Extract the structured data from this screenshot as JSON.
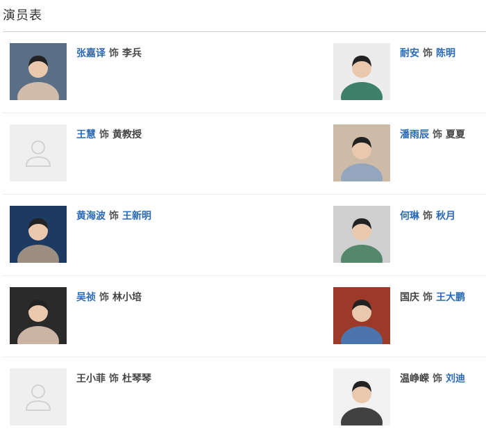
{
  "page": {
    "title": "演员表",
    "separator": "饰"
  },
  "cast": [
    {
      "actor": "张嘉译",
      "actor_link": true,
      "role": "李兵",
      "role_link": false,
      "photo": "photo",
      "photo_colors": [
        "#5a6f86",
        "#e6c9b1"
      ]
    },
    {
      "actor": "耐安",
      "actor_link": true,
      "role": "陈明",
      "role_link": true,
      "photo": "photo",
      "photo_colors": [
        "#ececec",
        "#1f6e53"
      ]
    },
    {
      "actor": "王慧",
      "actor_link": true,
      "role": "黄教授",
      "role_link": false,
      "photo": "placeholder-avatar",
      "photo_colors": [
        "#efefef",
        "#d2d2d2"
      ]
    },
    {
      "actor": "潘雨辰",
      "actor_link": true,
      "role": "夏夏",
      "role_link": false,
      "photo": "photo",
      "photo_colors": [
        "#cdbba8",
        "#8aa2c2"
      ]
    },
    {
      "actor": "黄海波",
      "actor_link": true,
      "role": "王新明",
      "role_link": true,
      "photo": "photo",
      "photo_colors": [
        "#1d3a63",
        "#b39d85"
      ]
    },
    {
      "actor": "何琳",
      "actor_link": true,
      "role": "秋月",
      "role_link": true,
      "photo": "photo",
      "photo_colors": [
        "#cfcfcf",
        "#3f7a5c"
      ]
    },
    {
      "actor": "吴祯",
      "actor_link": true,
      "role": "林小培",
      "role_link": false,
      "photo": "photo",
      "photo_colors": [
        "#2a2a2a",
        "#e8ccb8"
      ]
    },
    {
      "actor": "国庆",
      "actor_link": false,
      "role": "王大鹏",
      "role_link": true,
      "photo": "photo",
      "photo_colors": [
        "#9b3a28",
        "#3d7fc3"
      ]
    },
    {
      "actor": "王小菲",
      "actor_link": false,
      "role": "杜琴琴",
      "role_link": false,
      "photo": "placeholder-avatar",
      "photo_colors": [
        "#efefef",
        "#d2d2d2"
      ]
    },
    {
      "actor": "温峥嵘",
      "actor_link": false,
      "role": "刘迪",
      "role_link": true,
      "photo": "photo",
      "photo_colors": [
        "#f1f1f1",
        "#222222"
      ]
    }
  ]
}
